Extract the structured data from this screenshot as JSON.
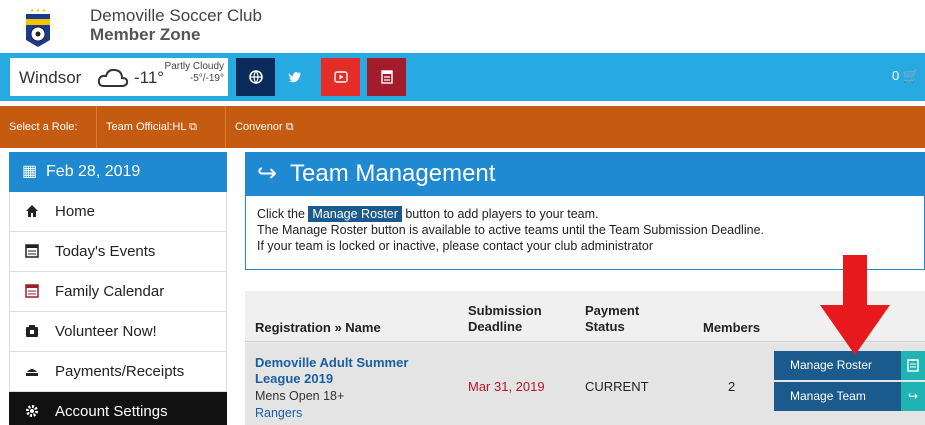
{
  "header": {
    "club_name": "Demoville Soccer Club",
    "zone": "Member Zone"
  },
  "weather": {
    "city": "Windsor",
    "temp": "-11°",
    "condition": "Partly Cloudy",
    "range": "-5°/-19°"
  },
  "social": [
    {
      "name": "website",
      "color": "#0a2a5c"
    },
    {
      "name": "twitter",
      "color": "#27a9e1"
    },
    {
      "name": "youtube",
      "color": "#e52d27"
    },
    {
      "name": "calendar",
      "color": "#a31c2c"
    }
  ],
  "cart": {
    "count": "0"
  },
  "roles": {
    "label": "Select a Role:",
    "items": [
      "Team Official:HL",
      "Convenor"
    ]
  },
  "sidebar": {
    "date": "Feb 28, 2019",
    "items": [
      "Home",
      "Today's Events",
      "Family Calendar",
      "Volunteer Now!",
      "Payments/Receipts",
      "Account Settings"
    ]
  },
  "team_mgmt": {
    "title": "Team Management",
    "line1_pre": "Click the ",
    "line1_hl": "Manage Roster",
    "line1_post": " button to add players to your team.",
    "line2": "The Manage Roster button is available to active teams until the Team Submission Deadline.",
    "line3": "If your team is locked or inactive, please contact your club administrator"
  },
  "table": {
    "headers": {
      "reg": "Registration » Name",
      "sub1": "Submission",
      "sub2": "Deadline",
      "pay1": "Payment",
      "pay2": "Status",
      "members": "Members"
    },
    "row": {
      "name1": "Demoville Adult Summer",
      "name2": "League 2019",
      "division": "Mens Open 18+",
      "team": "Rangers",
      "deadline": "Mar 31, 2019",
      "status": "CURRENT",
      "members": "2",
      "btn_roster": "Manage Roster",
      "btn_team": "Manage Team"
    }
  },
  "colors": {
    "accent": "#1f8ad1",
    "topbar": "#27a9e1",
    "rolebar": "#c55a11",
    "button": "#1a5a8c",
    "arrow": "#e8191c"
  }
}
